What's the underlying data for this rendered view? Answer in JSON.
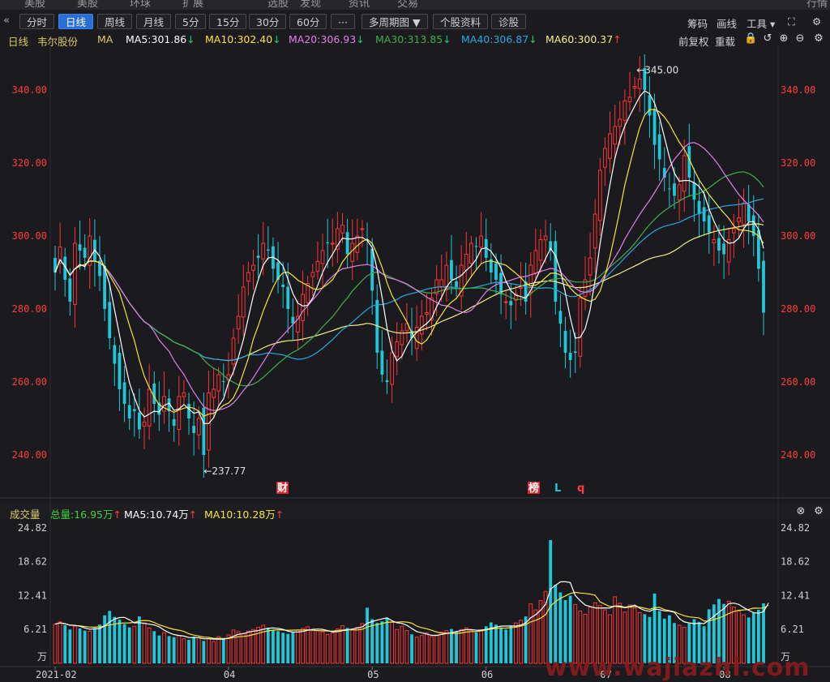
{
  "top_nav": [
    "美股",
    "美股",
    "环球",
    "扩展",
    "",
    "选股",
    "发现",
    "资讯",
    "交易",
    "行情"
  ],
  "toolbar": {
    "back_icon": "left-double-chevron",
    "buttons": [
      "分时",
      "日线",
      "周线",
      "月线",
      "5分",
      "15分",
      "30分",
      "60分",
      "···",
      "多周期图 ▼",
      "个股资料",
      "诊股"
    ],
    "active": "日线",
    "right": [
      "筹码",
      "画线",
      "工具 ▾",
      "⛶",
      "⚙"
    ]
  },
  "ma_bar": {
    "period": "日线",
    "stock_name": "韦尔股份",
    "ma_label": "MA",
    "items": [
      {
        "text": "MA5:301.86",
        "arrow": "↓",
        "color": "#ffffff",
        "arrow_color": "#19d36a"
      },
      {
        "text": "MA10:302.40",
        "arrow": "↓",
        "color": "#f5e43a",
        "arrow_color": "#19d36a"
      },
      {
        "text": "MA20:306.93",
        "arrow": "↓",
        "color": "#e27ee6",
        "arrow_color": "#19d36a"
      },
      {
        "text": "MA30:313.85",
        "arrow": "↓",
        "color": "#3fae4a",
        "arrow_color": "#19d36a"
      },
      {
        "text": "MA40:306.87",
        "arrow": "↓",
        "color": "#27a8e0",
        "arrow_color": "#19d36a"
      },
      {
        "text": "MA60:300.37",
        "arrow": "↑",
        "color": "#f3f08a",
        "arrow_color": "#ff3b3b"
      }
    ],
    "right": [
      "前复权",
      "重载"
    ]
  },
  "vol_bar": {
    "title": "成交量",
    "items": [
      {
        "text": "总量:16.95万",
        "arrow": "↑",
        "color": "#3fd13f"
      },
      {
        "text": "MA5:10.74万",
        "arrow": "↑",
        "color": "#ffffff"
      },
      {
        "text": "MA10:10.28万",
        "arrow": "↑",
        "color": "#f5e43a"
      }
    ]
  },
  "markers": {
    "cai": "财",
    "bang": "榜",
    "L": "L",
    "q": "q"
  },
  "annotations": {
    "high": "←345.00",
    "low": "←237.77"
  },
  "watermark": "www.wajiazhi.com",
  "chart_data": {
    "type": "candlestick",
    "price_axis": {
      "ticks": [
        "340.00",
        "320.00",
        "300.00",
        "280.00",
        "260.00",
        "240.00"
      ],
      "values": [
        340,
        320,
        300,
        280,
        260,
        240
      ],
      "range": [
        230,
        350
      ]
    },
    "volume_axis": {
      "ticks": [
        "24.82",
        "18.62",
        "12.41",
        "6.21",
        "万"
      ],
      "values": [
        24.82,
        18.62,
        12.41,
        6.21,
        0
      ],
      "unit": "万"
    },
    "x_labels": [
      {
        "label": "2021-02",
        "index": 0
      },
      {
        "label": "04",
        "index": 35
      },
      {
        "label": "05",
        "index": 64
      },
      {
        "label": "06",
        "index": 87
      },
      {
        "label": "07",
        "index": 111
      },
      {
        "label": "08",
        "index": 135
      }
    ],
    "colors": {
      "up": "#ff3232",
      "down": "#1fc8d8",
      "MA5": "#ffffff",
      "MA10": "#f5e43a",
      "MA20": "#e27ee6",
      "MA30": "#3fae4a",
      "MA40": "#27a8e0",
      "MA60": "#f3f08a"
    },
    "price_path": [
      290,
      297,
      288,
      282,
      298,
      296,
      294,
      300,
      293,
      289,
      280,
      272,
      265,
      258,
      254,
      250,
      252,
      247,
      249,
      258,
      254,
      251,
      256,
      252,
      248,
      256,
      257,
      250,
      246,
      250,
      240,
      257,
      258,
      262,
      260,
      262,
      272,
      278,
      286,
      290,
      292,
      294,
      298,
      296,
      291,
      288,
      286,
      280,
      276,
      278,
      284,
      287,
      290,
      293,
      296,
      298,
      298,
      302,
      303,
      295,
      298,
      300,
      302,
      299,
      285,
      268,
      262,
      260,
      268,
      271,
      274,
      276,
      272,
      275,
      278,
      279,
      283,
      288,
      288,
      292,
      288,
      286,
      292,
      295,
      298,
      297,
      300,
      294,
      290,
      288,
      284,
      282,
      281,
      284,
      286,
      282,
      292,
      296,
      299,
      300,
      296,
      282,
      276,
      268,
      266,
      268,
      283,
      288,
      294,
      306,
      318,
      324,
      328,
      330,
      332,
      337,
      338,
      341,
      343,
      340,
      333,
      325,
      321,
      316,
      313,
      311,
      314,
      322,
      316,
      310,
      306,
      304,
      301,
      299,
      296,
      295,
      299,
      302,
      305,
      309,
      304,
      300,
      291,
      279
    ],
    "volume_path": [
      7.2,
      7.6,
      7.0,
      6.2,
      6.8,
      6.4,
      6.0,
      5.9,
      6.5,
      7.1,
      8.8,
      9.6,
      8.5,
      8.0,
      7.2,
      6.6,
      6.8,
      8.6,
      7.4,
      6.5,
      5.9,
      5.1,
      5.6,
      5.0,
      4.8,
      5.1,
      4.5,
      4.3,
      4.9,
      4.7,
      4.1,
      4.5,
      4.0,
      4.9,
      4.6,
      5.2,
      6.1,
      5.8,
      5.5,
      5.9,
      6.2,
      6.6,
      7.0,
      6.5,
      6.1,
      5.9,
      5.6,
      5.4,
      5.7,
      6.1,
      6.4,
      6.7,
      6.2,
      6.0,
      5.8,
      5.3,
      5.6,
      6.3,
      6.9,
      6.5,
      6.1,
      6.6,
      7.3,
      10.2,
      8.1,
      7.4,
      7.7,
      8.3,
      7.6,
      6.2,
      6.8,
      6.0,
      5.3,
      4.8,
      5.1,
      5.6,
      4.9,
      5.2,
      5.7,
      6.0,
      6.3,
      5.9,
      6.2,
      6.5,
      6.0,
      5.7,
      6.1,
      6.8,
      7.5,
      7.1,
      6.6,
      6.2,
      6.9,
      7.4,
      7.9,
      8.6,
      10.9,
      9.8,
      11.5,
      13.2,
      22.6,
      14.4,
      13.0,
      11.6,
      12.4,
      10.8,
      9.6,
      9.0,
      10.3,
      11.1,
      10.6,
      9.8,
      8.9,
      12.2,
      11.0,
      9.4,
      10.7,
      10.1,
      9.3,
      9.0,
      8.5,
      12.8,
      9.6,
      8.2,
      8.8,
      7.4,
      7.0,
      6.6,
      7.3,
      8.1,
      7.6,
      6.8,
      9.9,
      10.8,
      11.8,
      10.9,
      11.4,
      10.3,
      9.6,
      8.9,
      8.4,
      9.2,
      9.8,
      11.0,
      16.95
    ]
  }
}
